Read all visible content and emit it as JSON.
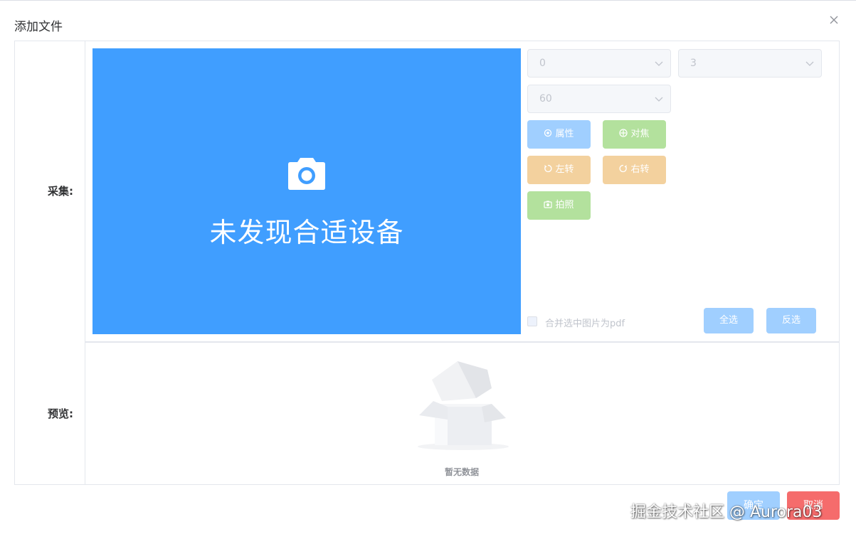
{
  "dialog": {
    "title": "添加文件"
  },
  "form": {
    "capture_label": "采集:",
    "preview_label": "预览:"
  },
  "video": {
    "message": "未发现合适设备",
    "background": "#409eff"
  },
  "selects": {
    "device": "0",
    "resolution": "3",
    "quality": "60"
  },
  "buttons": {
    "attributes": "属性",
    "focus": "对焦",
    "rotate_left": "左转",
    "rotate_right": "右转",
    "take_photo": "拍照",
    "select_all": "全选",
    "invert_selection": "反选"
  },
  "merge_pdf": {
    "label": "合并选中图片为pdf",
    "checked": false
  },
  "preview": {
    "empty_text": "暂无数据"
  },
  "footer": {
    "confirm": "确定",
    "cancel": "取消"
  },
  "watermark": "掘金技术社区 @ Aurora03",
  "colors": {
    "primary_light": "#a0cfff",
    "success_light": "#b3e19d",
    "warning_light": "#f3d19e",
    "danger": "#f56c6c"
  }
}
